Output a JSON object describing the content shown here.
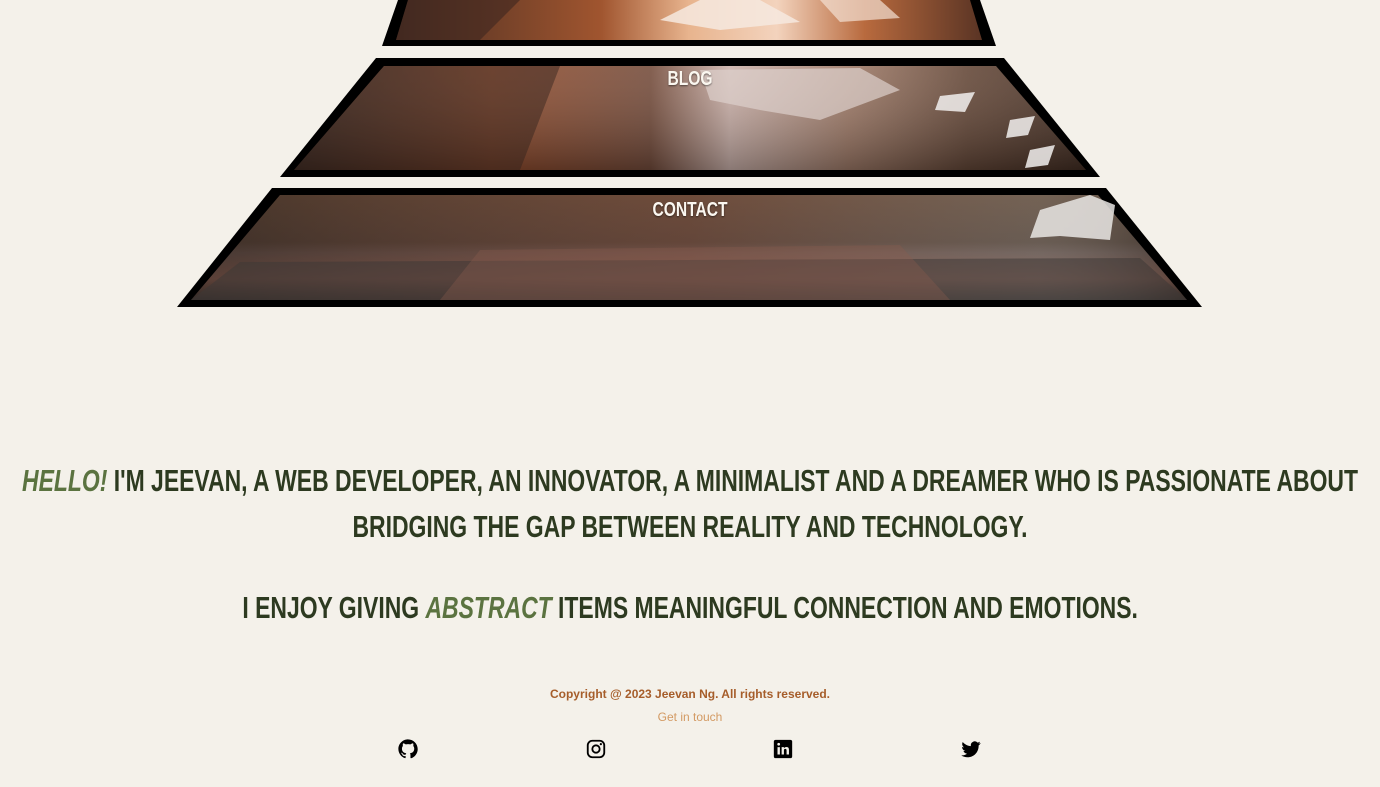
{
  "nav": {
    "tiers": [
      {
        "label": ""
      },
      {
        "label": "BLOG"
      },
      {
        "label": "CONTACT"
      }
    ]
  },
  "intro": {
    "line1_accent": "HELLO!",
    "line1_text": " I'M JEEVAN, A WEB DEVELOPER, AN INNOVATOR, A MINIMALIST AND A DREAMER WHO IS PASSIONATE ABOUT BRIDGING THE GAP BETWEEN REALITY AND TECHNOLOGY.",
    "line2_before": "I ENJOY GIVING ",
    "line2_accent": "ABSTRACT",
    "line2_after": " ITEMS MEANINGFUL CONNECTION AND EMOTIONS."
  },
  "footer": {
    "copyright": "Copyright @ 2023 Jeevan Ng. All rights reserved.",
    "get_in_touch": "Get in touch",
    "social": [
      {
        "icon": "github-icon"
      },
      {
        "icon": "instagram-icon"
      },
      {
        "icon": "linkedin-icon"
      },
      {
        "icon": "twitter-icon"
      }
    ]
  },
  "colors": {
    "background": "#f4f1ea",
    "heading": "#2d3a20",
    "accent": "#5b7340",
    "copyright": "#a65d2a",
    "link": "#d39a63"
  }
}
